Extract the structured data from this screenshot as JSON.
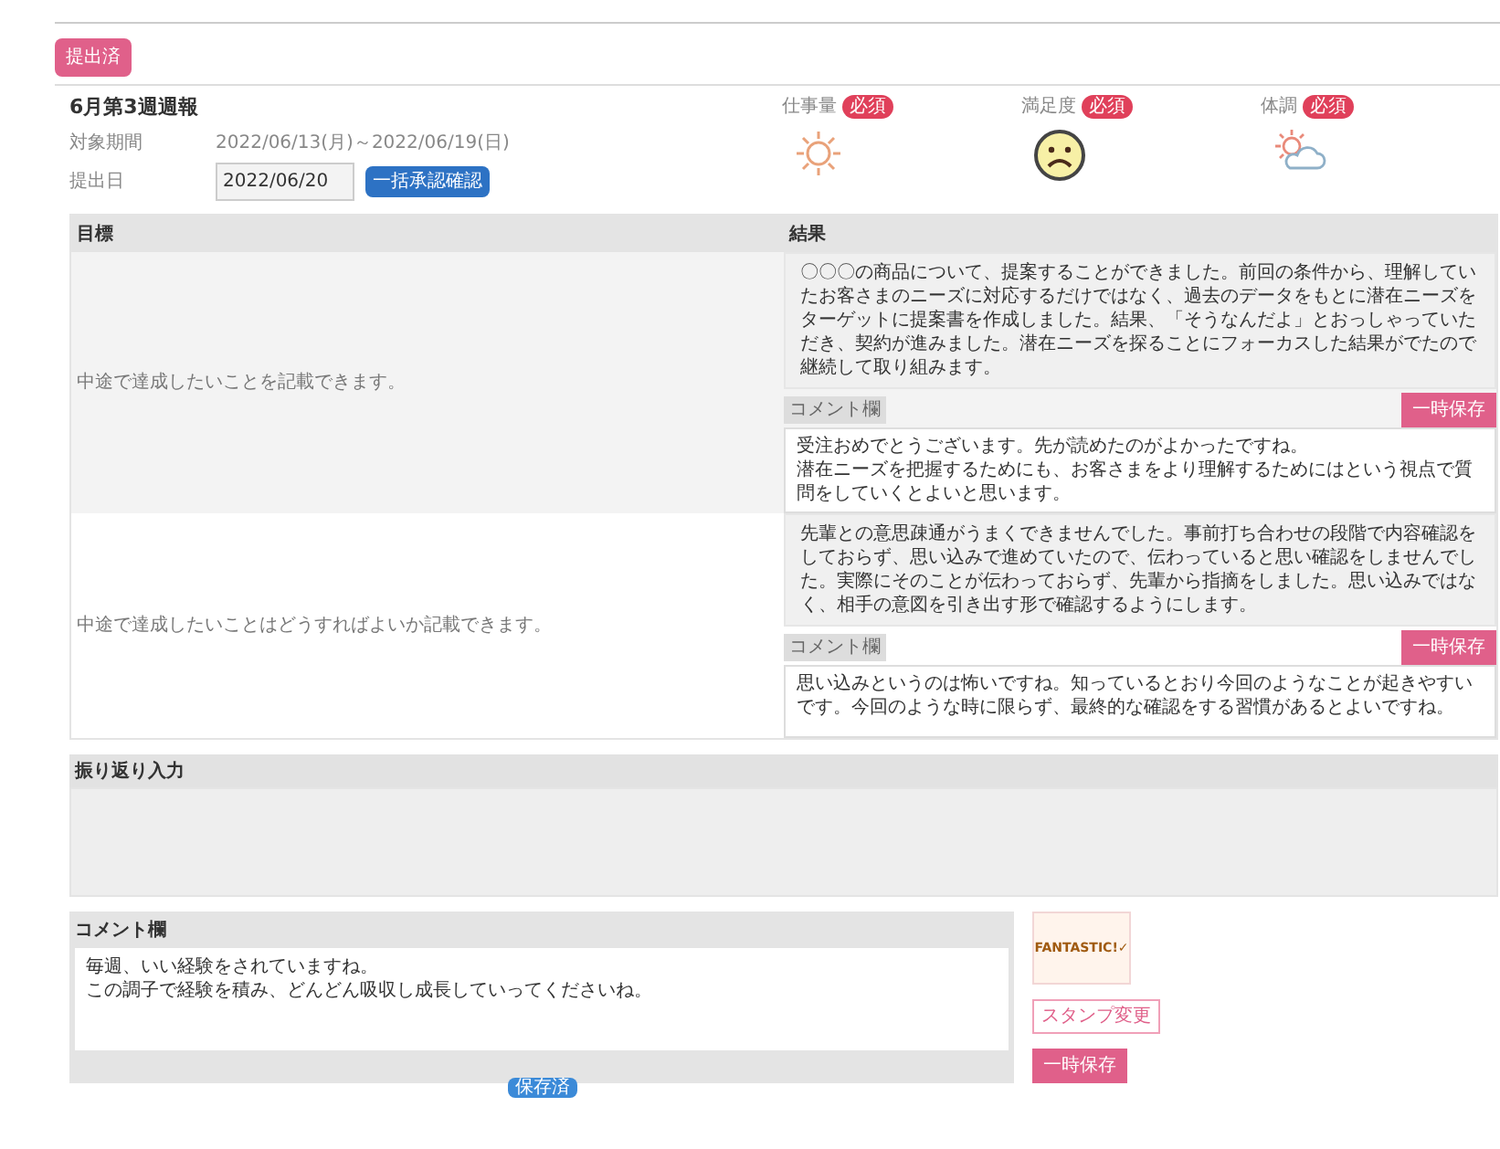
{
  "status_button": "提出済",
  "report": {
    "title": "6月第3週週報",
    "period_label": "対象期間",
    "period_value": "2022/06/13(月)～2022/06/19(日)",
    "date_label": "提出日",
    "date_value": "2022/06/20",
    "date_button": "一括承認確認"
  },
  "moods": [
    {
      "label": "仕事量",
      "badge": "必須",
      "kind": "sun"
    },
    {
      "label": "満足度",
      "badge": "必須",
      "kind": "sad"
    },
    {
      "label": "体調",
      "badge": "必須",
      "kind": "sun-cloud"
    }
  ],
  "table": {
    "columns": [
      "目標",
      "結果"
    ],
    "rows": [
      {
        "goal": "中途で達成したいことを記載できます。",
        "result": "〇〇〇の商品について、提案することができました。前回の条件から、理解していたお客さまのニーズに対応するだけではなく、過去のデータをもとに潜在ニーズをターゲットに提案書を作成しました。結果、「そうなんだよ」とおっしゃっていただき、契約が進みました。潜在ニーズを探ることにフォーカスした結果がでたので継続して取り組みます。",
        "comment_label": "コメント欄",
        "comment_button": "一時保存",
        "comment": [
          "受注おめでとうございます。先が読めたのがよかったですね。",
          "潜在ニーズを把握するためにも、お客さまをより理解するためにはという視点で質問をしていくとよいと思います。"
        ]
      },
      {
        "goal": "中途で達成したいことはどうすればよいか記載できます。",
        "result": "先輩との意思疎通がうまくできませんでした。事前打ち合わせの段階で内容確認をしておらず、思い込みで進めていたので、伝わっていると思い確認をしませんでした。実際にそのことが伝わっておらず、先輩から指摘をしました。思い込みではなく、相手の意図を引き出す形で確認するようにします。",
        "comment_label": "コメント欄",
        "comment_button": "一時保存",
        "comment": [
          "思い込みというのは怖いですね。知っているとおり今回のようなことが起きやすいです。今回のような時に限らず、最終的な確認をする習慣があるとよいですね。"
        ]
      }
    ]
  },
  "memo": {
    "label": "振り返り入力"
  },
  "comment_panel": {
    "label": "コメント欄",
    "text": [
      "毎週、いい経験をされていますね。",
      "この調子で経験を積み、どんどん吸収し成長していってくださいね。"
    ],
    "tag": "保存済"
  },
  "stamp": {
    "text": "FANTASTIC!✓",
    "change_button": "スタンプ変更",
    "save_button": "一時保存"
  }
}
